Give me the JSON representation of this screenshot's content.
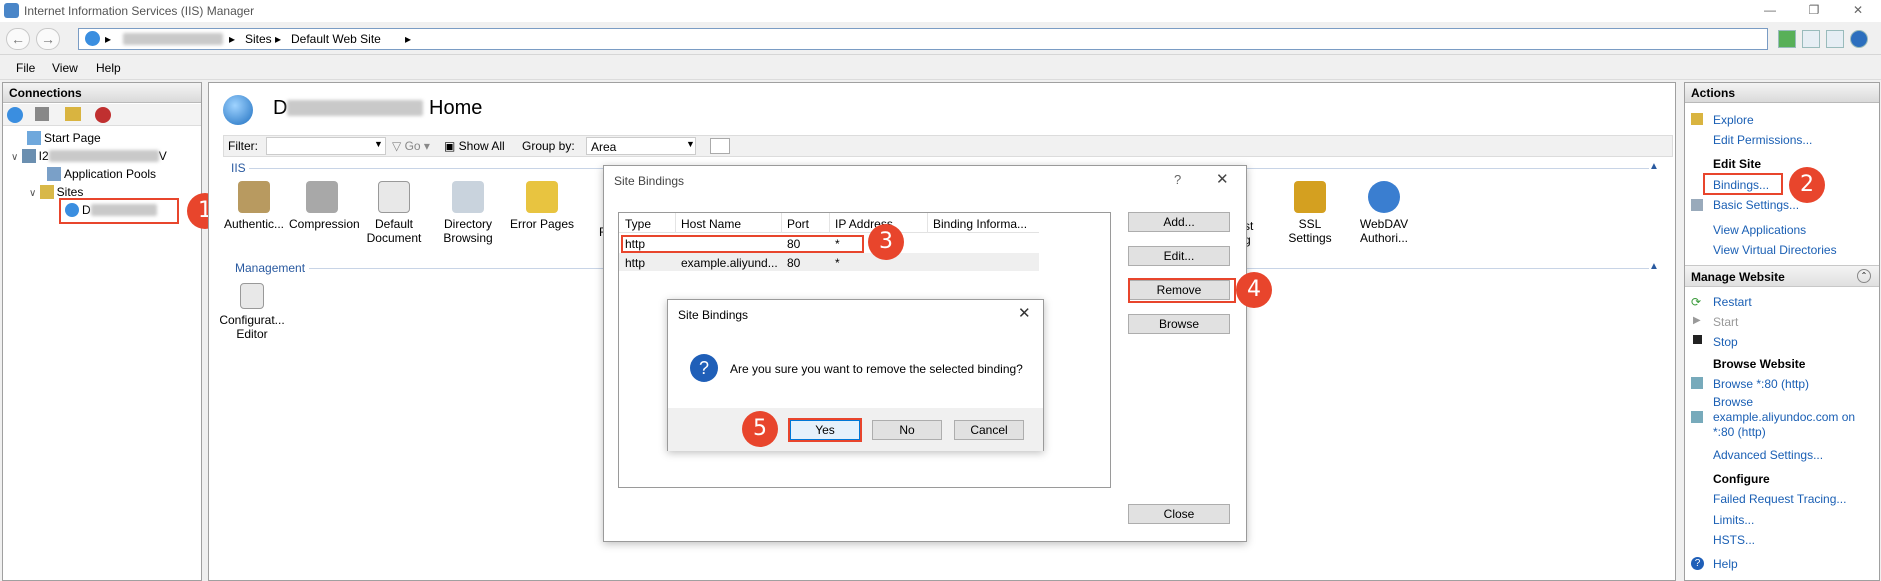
{
  "window": {
    "title": "Internet Information Services (IIS) Manager"
  },
  "address": {
    "seg_sites": "Sites",
    "seg_site": "Default Web Site"
  },
  "menu": [
    "File",
    "View",
    "Help"
  ],
  "connections": {
    "title": "Connections",
    "start_page": "Start Page",
    "server_prefix": "I2",
    "server_suffix": "V",
    "app_pools": "Application Pools",
    "sites": "Sites",
    "site_prefix": "D"
  },
  "home": {
    "title_prefix": "D",
    "title_suffix": " Home",
    "filter_label": "Filter:",
    "go": "Go",
    "show_all": "Show All",
    "group_by": "Group by:",
    "group_value": "Area",
    "section_iis": "IIS",
    "section_mgmt": "Management",
    "features": [
      "Authentic...",
      "Compression",
      "Default Document",
      "Directory Browsing",
      "Error Pages",
      "SSL Settings",
      "WebDAV Authori..."
    ],
    "partial_f": "F",
    "partial_st": "st",
    "partial_g": "g",
    "mgmt_features": [
      "Configurat... Editor"
    ]
  },
  "bindings_dialog": {
    "title": "Site Bindings",
    "help": "?",
    "columns": [
      "Type",
      "Host Name",
      "Port",
      "IP Address",
      "Binding Informa..."
    ],
    "rows": [
      {
        "type": "http",
        "host": "",
        "port": "80",
        "ip": "*"
      },
      {
        "type": "http",
        "host": "example.aliyund...",
        "port": "80",
        "ip": "*"
      }
    ],
    "buttons": {
      "add": "Add...",
      "edit": "Edit...",
      "remove": "Remove",
      "browse": "Browse",
      "close": "Close"
    }
  },
  "confirm_dialog": {
    "title": "Site Bindings",
    "message": "Are you sure you want to remove the selected binding?",
    "yes": "Yes",
    "no": "No",
    "cancel": "Cancel"
  },
  "actions": {
    "title": "Actions",
    "explore": "Explore",
    "edit_permissions": "Edit Permissions...",
    "edit_site": "Edit Site",
    "bindings": "Bindings...",
    "basic_settings": "Basic Settings...",
    "view_applications": "View Applications",
    "view_vdirs": "View Virtual Directories",
    "manage_website": "Manage Website",
    "restart": "Restart",
    "start": "Start",
    "stop": "Stop",
    "browse_website": "Browse Website",
    "browse_80": "Browse *:80 (http)",
    "browse_example_1": "Browse",
    "browse_example_2": "example.aliyundoc.com on",
    "browse_example_3": "*:80 (http)",
    "advanced_settings": "Advanced Settings...",
    "configure": "Configure",
    "failed_request": "Failed Request Tracing...",
    "limits": "Limits...",
    "hsts": "HSTS...",
    "help": "Help"
  },
  "callouts": [
    "1",
    "2",
    "3",
    "4",
    "5"
  ],
  "colors": {
    "callout": "#e8452c",
    "link": "#1a5fb4"
  }
}
